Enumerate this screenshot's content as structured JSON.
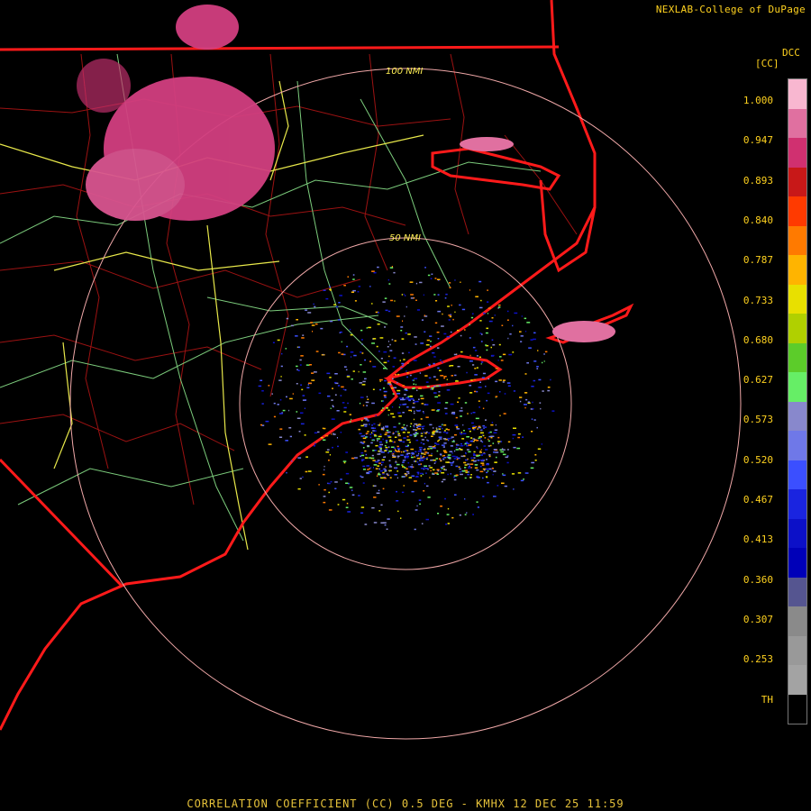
{
  "credit": "NEXLAB-College of DuPage",
  "footer": "CORRELATION COEFFICIENT (CC) 0.5 DEG - KMHX 12 DEC 25 11:59",
  "map": {
    "ring_labels": [
      "100 NMI",
      "50 NMI"
    ],
    "colors": {
      "state_border": "#ff1a1a",
      "county_border": "#a01010",
      "highway_us": "#ffff55",
      "highway_state": "#77dd77",
      "range_ring": "#f0a0a0"
    }
  },
  "legend": {
    "title": "DCC",
    "unit": "[CC]",
    "ticks": [
      "1.000",
      "0.947",
      "0.893",
      "0.840",
      "0.787",
      "0.733",
      "0.680",
      "0.627",
      "0.573",
      "0.520",
      "0.467",
      "0.413",
      "0.360",
      "0.307",
      "0.253",
      "TH"
    ],
    "colors": [
      "#f8b7d0",
      "#e070a0",
      "#d03070",
      "#c81818",
      "#ff3a00",
      "#ff7a00",
      "#ffb400",
      "#e8e000",
      "#b0d000",
      "#5ccc2a",
      "#66ee66",
      "#8888cc",
      "#6f78e8",
      "#3b4fff",
      "#1a24e0",
      "#0c10c8",
      "#0000b8",
      "#555590",
      "#8a8a8a",
      "#999999",
      "#a3a3a3",
      "#000000"
    ]
  }
}
